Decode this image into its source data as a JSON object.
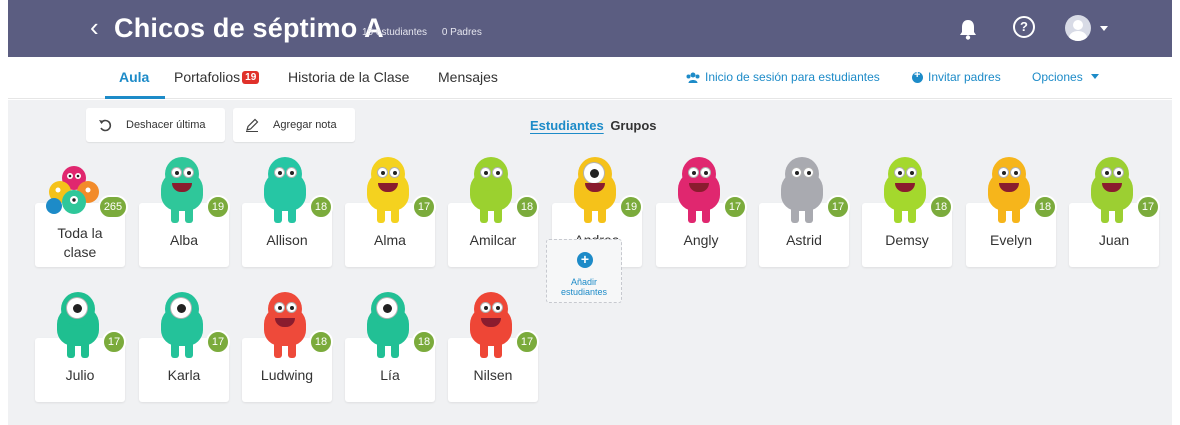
{
  "header": {
    "back_glyph": "‹",
    "title": "Chicos de séptimo A",
    "students_count": "15 estudiantes",
    "parents_count": "0 Padres",
    "icons": [
      "bell-icon",
      "help-icon",
      "avatar"
    ]
  },
  "tabs": {
    "aula": "Aula",
    "portafolios": "Portafolios",
    "portafolios_badge": "19",
    "historia": "Historia de la Clase",
    "mensajes": "Mensajes"
  },
  "links": {
    "student_login": "Inicio de sesión para estudiantes",
    "invite_parents": "Invitar padres",
    "options": "Opciones"
  },
  "toolbar": {
    "undo": "Deshacer última",
    "add_note": "Agregar nota",
    "view_students": "Estudiantes",
    "view_groups": "Grupos"
  },
  "whole_class": {
    "name_line1": "Toda la",
    "name_line2": "clase",
    "points": "265"
  },
  "students": [
    {
      "name": "Alba",
      "points": "19",
      "color": "#2fc79a",
      "eyes": 2,
      "mouth": true
    },
    {
      "name": "Allison",
      "points": "18",
      "color": "#26c6a4",
      "eyes": 2,
      "mouth": false
    },
    {
      "name": "Alma",
      "points": "17",
      "color": "#f4d21f",
      "eyes": 2,
      "mouth": true
    },
    {
      "name": "Amilcar",
      "points": "18",
      "color": "#9bd12f",
      "eyes": 2,
      "mouth": false
    },
    {
      "name": "Andrea",
      "points": "19",
      "color": "#f5c21a",
      "eyes": 1,
      "mouth": true
    },
    {
      "name": "Angly",
      "points": "17",
      "color": "#e0276f",
      "eyes": 2,
      "mouth": true
    },
    {
      "name": "Astrid",
      "points": "17",
      "color": "#a9aab0",
      "eyes": 2,
      "mouth": false
    },
    {
      "name": "Demsy",
      "points": "18",
      "color": "#a4d82d",
      "eyes": 2,
      "mouth": true
    },
    {
      "name": "Evelyn",
      "points": "18",
      "color": "#f6b51b",
      "eyes": 2,
      "mouth": true
    },
    {
      "name": "Juan",
      "points": "17",
      "color": "#9ccf32",
      "eyes": 2,
      "mouth": true
    },
    {
      "name": "Julio",
      "points": "17",
      "color": "#1fbf90",
      "eyes": 1,
      "mouth": false
    },
    {
      "name": "Karla",
      "points": "17",
      "color": "#24c29a",
      "eyes": 1,
      "mouth": false
    },
    {
      "name": "Ludwing",
      "points": "18",
      "color": "#ee4a3a",
      "eyes": 2,
      "mouth": true
    },
    {
      "name": "Lía",
      "points": "18",
      "color": "#22c095",
      "eyes": 1,
      "mouth": false
    },
    {
      "name": "Nilsen",
      "points": "17",
      "color": "#ee4636",
      "eyes": 2,
      "mouth": true
    }
  ],
  "add_students": {
    "plus": "+",
    "line1": "Añadir",
    "line2": "estudiantes"
  },
  "colors": {
    "topbar": "#5b5d81",
    "accent": "#1d8bc8",
    "points": "#7bab3c",
    "badge": "#e0312a"
  }
}
